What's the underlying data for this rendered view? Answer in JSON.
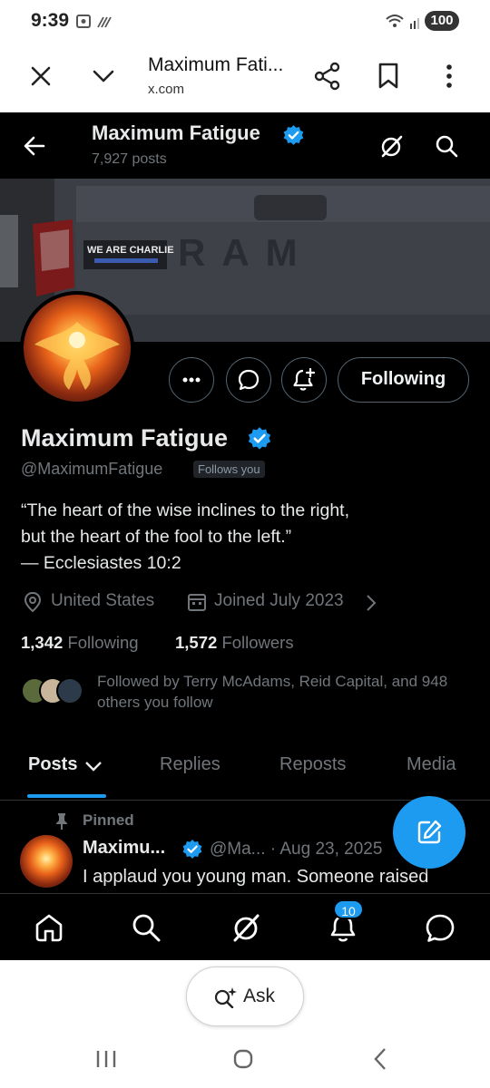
{
  "status": {
    "time": "9:39",
    "battery": "100"
  },
  "browser": {
    "title": "Maximum Fati...",
    "url": "x.com"
  },
  "profile": {
    "display_name": "Maximum Fatigue",
    "post_count": "7,927 posts",
    "handle": "@MaximumFatigue",
    "follows_you": "Follows you",
    "bio": "“The heart of the wise inclines to the right,\nbut the heart of the fool to the left.”\n— Ecclesiastes 10:2",
    "location": "United States",
    "joined": "Joined July 2023",
    "following_count": "1,342",
    "following_label": "Following",
    "followers_count": "1,572",
    "followers_label": "Followers",
    "followed_by": "Followed by Terry McAdams, Reid Capital, and 948 others you follow",
    "follow_button": "Following"
  },
  "banner": {
    "bumper_sticker": "WE ARE CHARLIE",
    "brand": "RAM"
  },
  "tabs": [
    {
      "label": "Posts"
    },
    {
      "label": "Replies"
    },
    {
      "label": "Reposts"
    },
    {
      "label": "Media"
    }
  ],
  "pinned_post": {
    "pinned_label": "Pinned",
    "author": "Maximu...",
    "meta": "@Ma... · Aug 23, 2025",
    "text": "I applaud you young man. Someone raised"
  },
  "bottom_nav": {
    "notification_count": "10"
  },
  "ask": {
    "label": "Ask"
  },
  "colors": {
    "accent": "#1d9bf0",
    "background": "#000000",
    "muted": "#71767b"
  }
}
